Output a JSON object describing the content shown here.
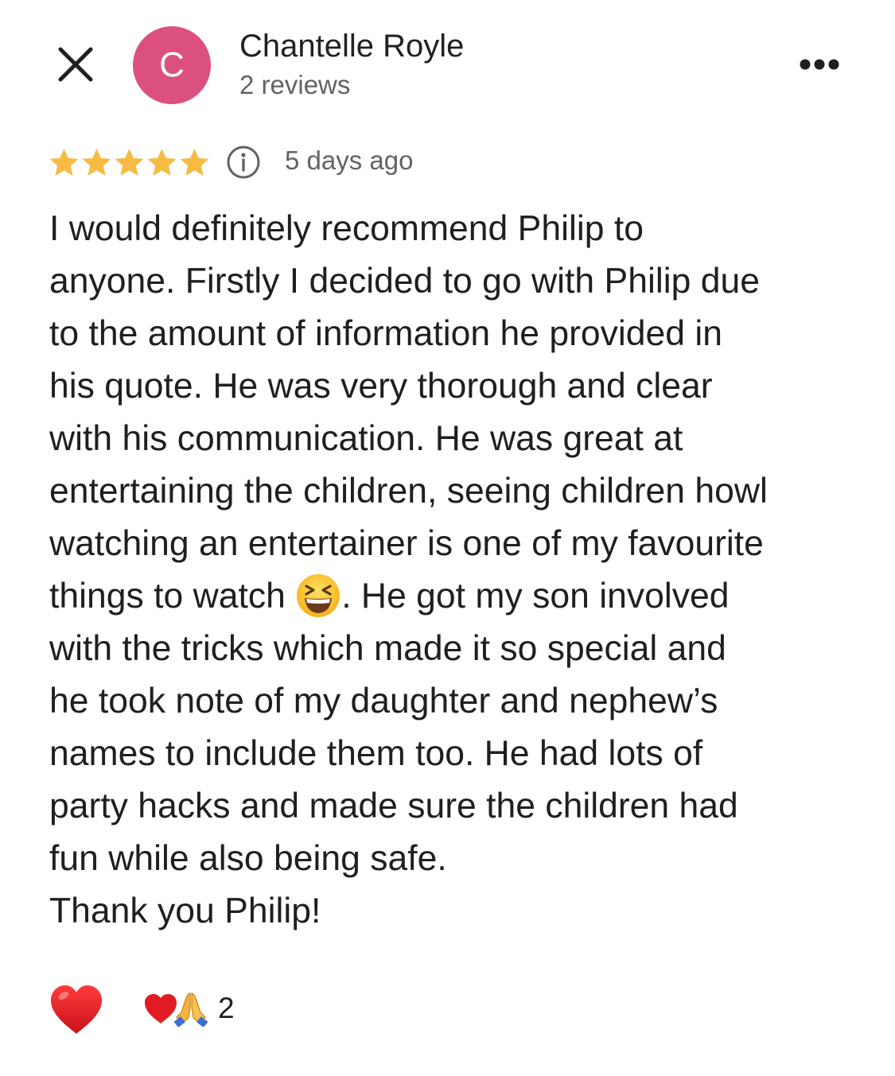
{
  "header": {
    "close_icon": "close-icon",
    "avatar_letter": "C",
    "avatar_color": "#dc5080",
    "author_name": "Chantelle Royle",
    "author_subtitle": "2 reviews",
    "more_icon": "more-horizontal-icon"
  },
  "rating": {
    "stars": 5,
    "max_stars": 5,
    "star_color": "#f6bb42",
    "info_icon": "info-icon",
    "date": "5 days ago"
  },
  "review": {
    "text_part1": "I would definitely recommend Philip to\nanyone. Firstly I decided to go with Philip due\nto the amount of information he provided in\nhis quote. He was very thorough and clear\nwith his communication. He was great at\nentertaining the children, seeing children howl\nwatching an entertainer is one of my favourite\nthings to watch ",
    "emoji": "grinning-squinting-face-emoji",
    "text_part2": ". He got my son involved\nwith the tricks which made it so special and\nhe took note of my daughter and nephew’s\nnames to include them too. He had lots of\nparty hacks and made sure the children had\nfun while also being safe.\nThank you Philip!"
  },
  "reactions": {
    "react_button_icon": "red-heart-icon",
    "summary_icons": [
      "red-heart-icon",
      "folded-hands-icon"
    ],
    "count": "2"
  }
}
